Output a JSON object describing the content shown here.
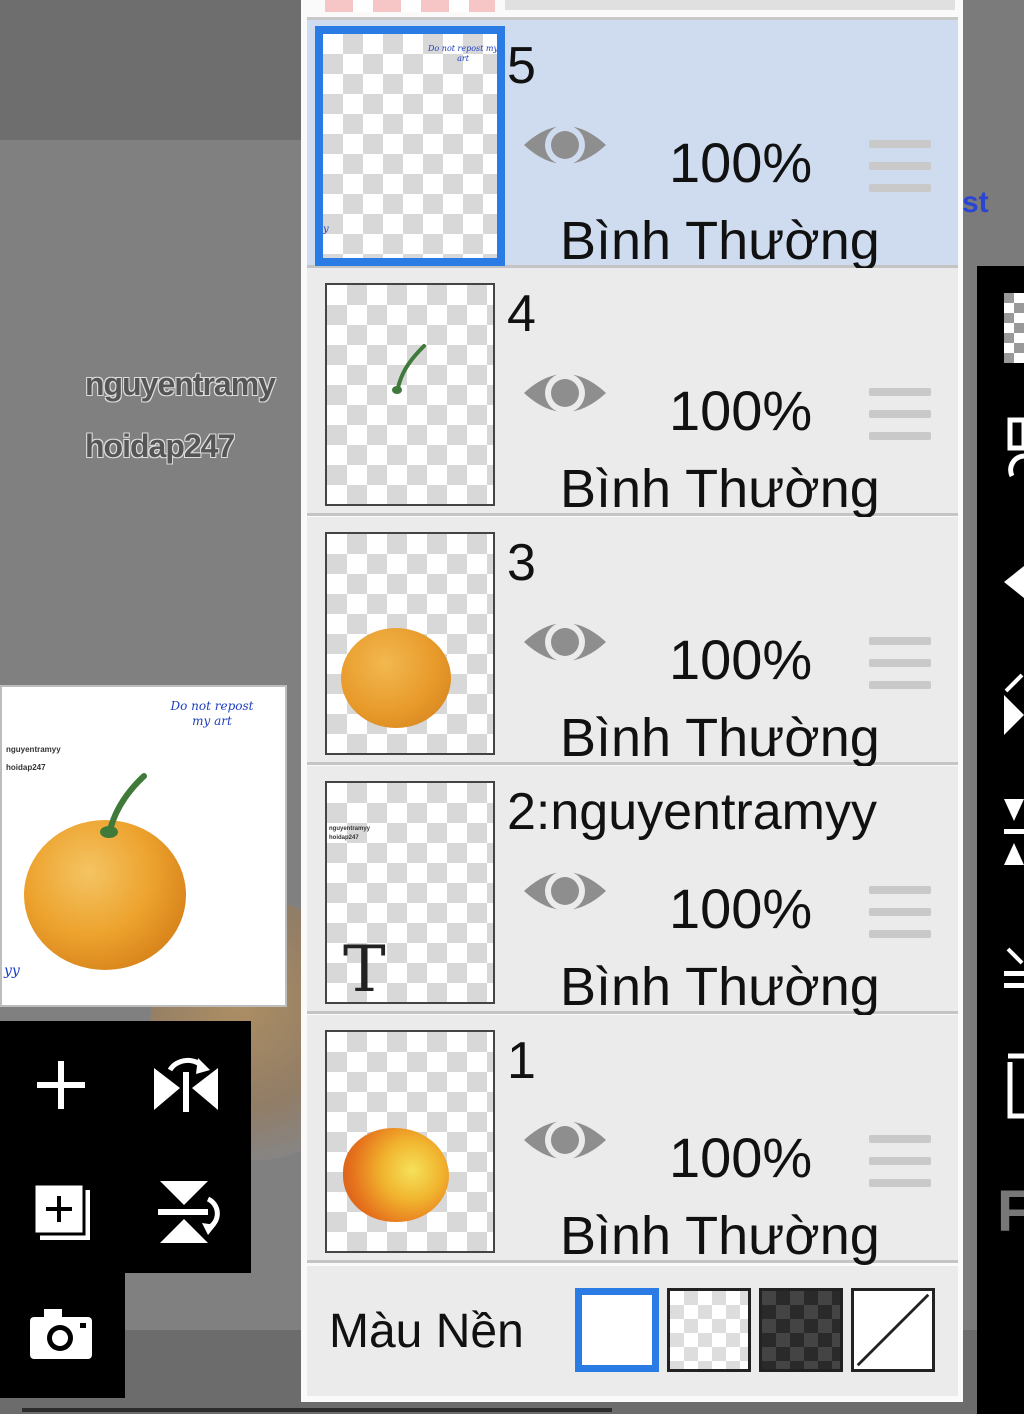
{
  "canvas": {
    "watermark_line1": "nguyentramy",
    "watermark_line2": "hoidap247"
  },
  "preview": {
    "note": "Do not repost my art",
    "wm_line1": "nguyentramyy",
    "wm_line2": "hoidap247",
    "signature": "yy"
  },
  "right_edge_text": "st",
  "layers": [
    {
      "name": "5",
      "opacity": "100%",
      "blend": "Bình Thường",
      "selected": true,
      "visible": true
    },
    {
      "name": "4",
      "opacity": "100%",
      "blend": "Bình Thường",
      "selected": false,
      "visible": true
    },
    {
      "name": "3",
      "opacity": "100%",
      "blend": "Bình Thường",
      "selected": false,
      "visible": true
    },
    {
      "name": "2:nguyentramyy",
      "opacity": "100%",
      "blend": "Bình Thường",
      "selected": false,
      "visible": true,
      "thumb_glyph": "T"
    },
    {
      "name": "1",
      "opacity": "100%",
      "blend": "Bình Thường",
      "selected": false,
      "visible": true
    }
  ],
  "background": {
    "label": "Màu Nền",
    "options": [
      "white",
      "transparent",
      "dark-checker",
      "none"
    ],
    "selected": "white"
  },
  "layer5_thumb": {
    "note": "Do not repost my art",
    "sign": "y"
  },
  "layer2_thumb": {
    "line1": "nguyentramyy",
    "line2": "hoidap247"
  },
  "icons": {
    "add_layer": "plus-icon",
    "flip_h": "flip-horizontal-icon",
    "add_folder": "add-layer-copy-icon",
    "flip_v": "flip-vertical-icon",
    "camera": "camera-icon"
  },
  "colors": {
    "selection_blue": "#2b7be4",
    "selected_row": "#cfdcef",
    "orange": "#eda32e"
  }
}
